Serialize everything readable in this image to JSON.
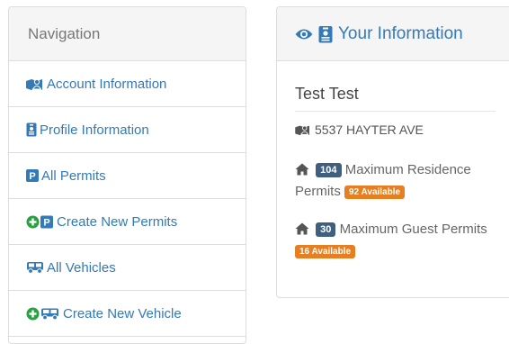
{
  "nav": {
    "title": "Navigation",
    "items": [
      {
        "label": "Account Information",
        "icon": "map-user-icon"
      },
      {
        "label": "Profile Information",
        "icon": "id-badge-icon"
      },
      {
        "label": "All Permits",
        "icon": "parking-icon"
      },
      {
        "label": "Create New Permits",
        "icon": "plus-parking-icon"
      },
      {
        "label": "All Vehicles",
        "icon": "bus-icon"
      },
      {
        "label": "Create New Vehicle",
        "icon": "plus-bus-icon"
      }
    ]
  },
  "info": {
    "title": "Your Information",
    "name": "Test Test",
    "address": "5537 HAYTER AVE",
    "residence": {
      "count": "104",
      "label": "Maximum Residence Permits",
      "available": "92 Available"
    },
    "guest": {
      "count": "30",
      "label": "Maximum Guest Permits",
      "available": "16 Available"
    }
  },
  "colors": {
    "link": "#337ab7",
    "badge": "#3f5f7f",
    "available": "#e67e22",
    "green": "#2e9e45"
  }
}
